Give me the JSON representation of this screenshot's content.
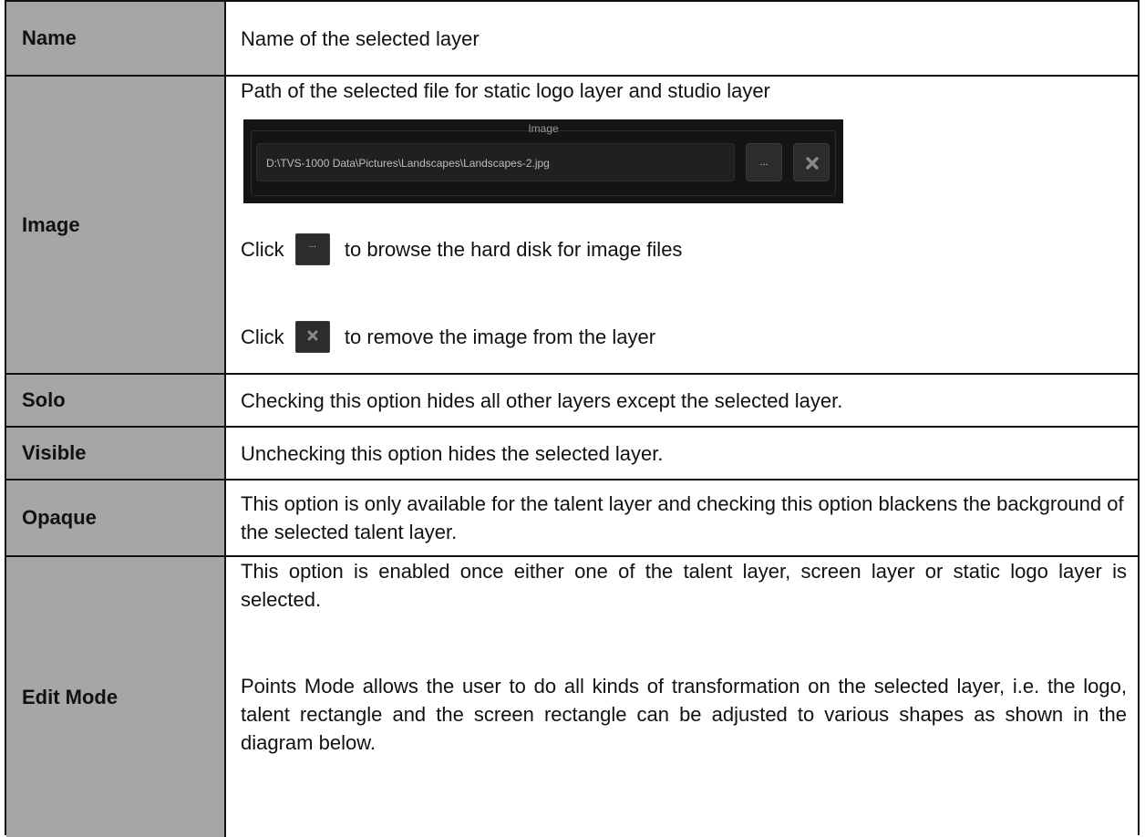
{
  "rows": {
    "name": {
      "label": "Name",
      "desc": "Name of the selected layer"
    },
    "image": {
      "label": "Image",
      "desc": "Path of the selected file for static logo layer and studio layer",
      "widget": {
        "title": "Image",
        "path": "D:\\TVS-1000 Data\\Pictures\\Landscapes\\Landscapes-2.jpg",
        "browse_label": "...",
        "remove_icon": "close-icon"
      },
      "browse": {
        "pre": "Click",
        "post": "to browse the hard disk for image files",
        "button_label": "..."
      },
      "remove": {
        "pre": "Click",
        "post": "to remove the image from the layer"
      }
    },
    "solo": {
      "label": "Solo",
      "desc": "Checking this option hides all other layers except the selected layer."
    },
    "visible": {
      "label": "Visible",
      "desc": "Unchecking this option hides the selected layer."
    },
    "opaque": {
      "label": "Opaque",
      "desc": "This option is only available for the talent layer and checking this option blackens the background of the selected talent layer."
    },
    "edit_mode": {
      "label": "Edit Mode",
      "p1": "This option is enabled once either one of the talent layer, screen layer or static logo layer is selected.",
      "p2": "Points Mode allows the user to do all kinds of transformation on the selected layer, i.e. the logo, talent rectangle and the screen rectangle can be adjusted to various shapes as shown in the diagram below."
    }
  }
}
